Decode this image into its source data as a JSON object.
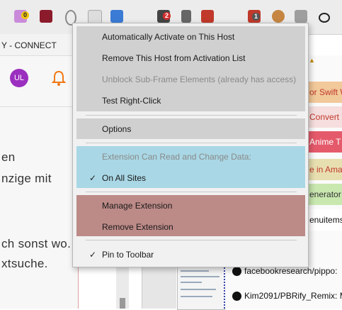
{
  "toolbar": {
    "badges": [
      "0",
      "2",
      "1"
    ]
  },
  "bookmarks": {
    "item": "Y - CONNECT"
  },
  "left_page": {
    "avatar_initials": "UL",
    "lines": [
      "en",
      "nzige mit",
      "ch sonst wo.",
      "xtsuche."
    ]
  },
  "tabs": [
    {
      "label": "or Swift W",
      "color": "#f2c99a",
      "text_color": "#c0392b"
    },
    {
      "label": "Convert",
      "color": "#f6dede",
      "text_color": "#c0392b"
    },
    {
      "label": "Anime T",
      "color": "#e55a6b",
      "text_color": "#ffffff"
    },
    {
      "label": "e in Amaz",
      "color": "#e8dfb0",
      "text_color": "#c0392b"
    },
    {
      "label": "enerator &",
      "color": "#c9e8b0",
      "text_color": "#333333"
    },
    {
      "label": "enuitems",
      "color": "#ffffff",
      "text_color": "#111111"
    }
  ],
  "github_rows": [
    "facebookresearch/pippo:",
    "Kim2091/PBRify_Remix: M"
  ],
  "context_menu": {
    "host_group": [
      {
        "label": "Automatically Activate on This Host",
        "disabled": false
      },
      {
        "label": "Remove This Host from Activation List",
        "disabled": false
      },
      {
        "label": "Unblock Sub-Frame Elements (already has access)",
        "disabled": true
      },
      {
        "label": "Test Right-Click",
        "disabled": false
      }
    ],
    "options_label": "Options",
    "access_heading": "Extension Can Read and Change Data:",
    "access_option": "On All Sites",
    "manage_label": "Manage Extension",
    "remove_label": "Remove Extension",
    "pin_label": "Pin to Toolbar",
    "check_glyph": "✓"
  },
  "colors": {
    "host_group_bg": "#d0d0d0",
    "access_group_bg": "#a9d7e5",
    "manage_group_bg": "#bc8a87",
    "menu_bg": "#f1f1f1"
  }
}
